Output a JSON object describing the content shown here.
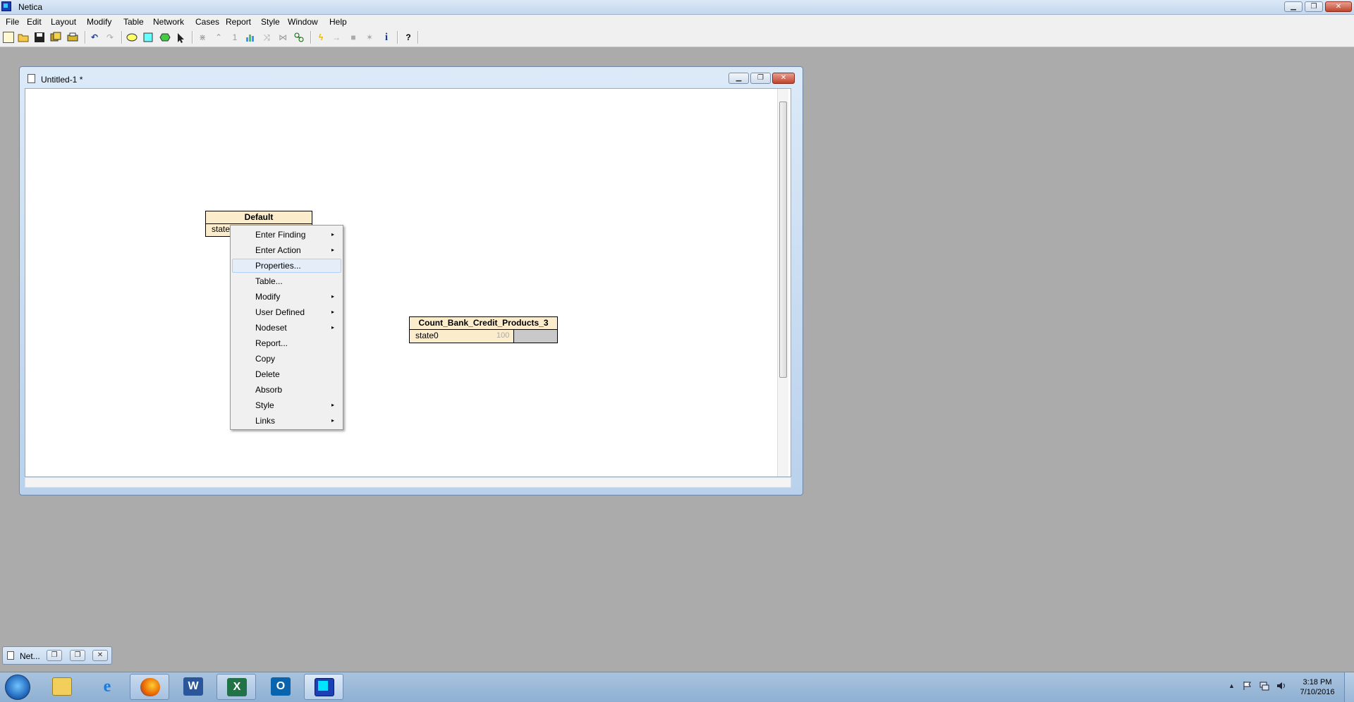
{
  "app": {
    "title": "Netica"
  },
  "window_controls": {
    "minimize": "▁",
    "restore": "❐",
    "close": "✕"
  },
  "menubar": [
    "File",
    "Edit",
    "Layout",
    "Modify",
    "Table",
    "Network",
    "Cases",
    "Report",
    "Style",
    "Window",
    "Help"
  ],
  "toolbar": {
    "icons": [
      "new-file-icon",
      "open-folder-icon",
      "save-icon",
      "save-all-icon",
      "print-icon",
      "undo-icon",
      "redo-icon",
      "ellipse-node-icon",
      "rectangle-node-icon",
      "hexagon-node-icon",
      "select-arrow-icon",
      "link-icon",
      "absorb-icon",
      "number-one-icon",
      "chart-icon",
      "reverse-link-icon",
      "reduce-icon",
      "optimize-icon",
      "compile-icon",
      "arrow-right-icon",
      "mark-icon",
      "star-icon",
      "info-icon",
      "help-icon"
    ],
    "one_label": "1",
    "info_label": "i",
    "help_label": "?"
  },
  "document": {
    "title": "Untitled-1 *",
    "controls": {
      "minimize": "▁",
      "restore": "❐",
      "close": "✕"
    }
  },
  "nodes": [
    {
      "name": "Default",
      "state": "state"
    },
    {
      "name": "Count_Bank_Credit_Products_3",
      "state": "state0",
      "value": "100"
    }
  ],
  "context_menu": {
    "items": [
      {
        "label": "Enter Finding",
        "submenu": true
      },
      {
        "label": "Enter Action",
        "submenu": true
      },
      {
        "label": "Properties...",
        "submenu": false,
        "highlighted": true
      },
      {
        "label": "Table...",
        "submenu": false
      },
      {
        "label": "Modify",
        "submenu": true
      },
      {
        "label": "User Defined",
        "submenu": true
      },
      {
        "label": "Nodeset",
        "submenu": true
      },
      {
        "label": "Report...",
        "submenu": false
      },
      {
        "label": "Copy",
        "submenu": false
      },
      {
        "label": "Delete",
        "submenu": false
      },
      {
        "label": "Absorb",
        "submenu": false
      },
      {
        "label": "Style",
        "submenu": true
      },
      {
        "label": "Links",
        "submenu": true
      }
    ],
    "arrow": "▸"
  },
  "minimized_window": {
    "title": "Net..."
  },
  "taskbar": {
    "apps": [
      "file-explorer-icon",
      "internet-explorer-icon",
      "firefox-icon",
      "word-icon",
      "excel-icon",
      "outlook-icon",
      "netica-icon"
    ],
    "word_letter": "W",
    "excel_letter": "X",
    "outlook_letter": "O",
    "ie_letter": "e",
    "tray": [
      "show-hidden-icon",
      "flag-icon",
      "network-icon",
      "volume-icon"
    ],
    "time": "3:18 PM",
    "date": "7/10/2016"
  }
}
